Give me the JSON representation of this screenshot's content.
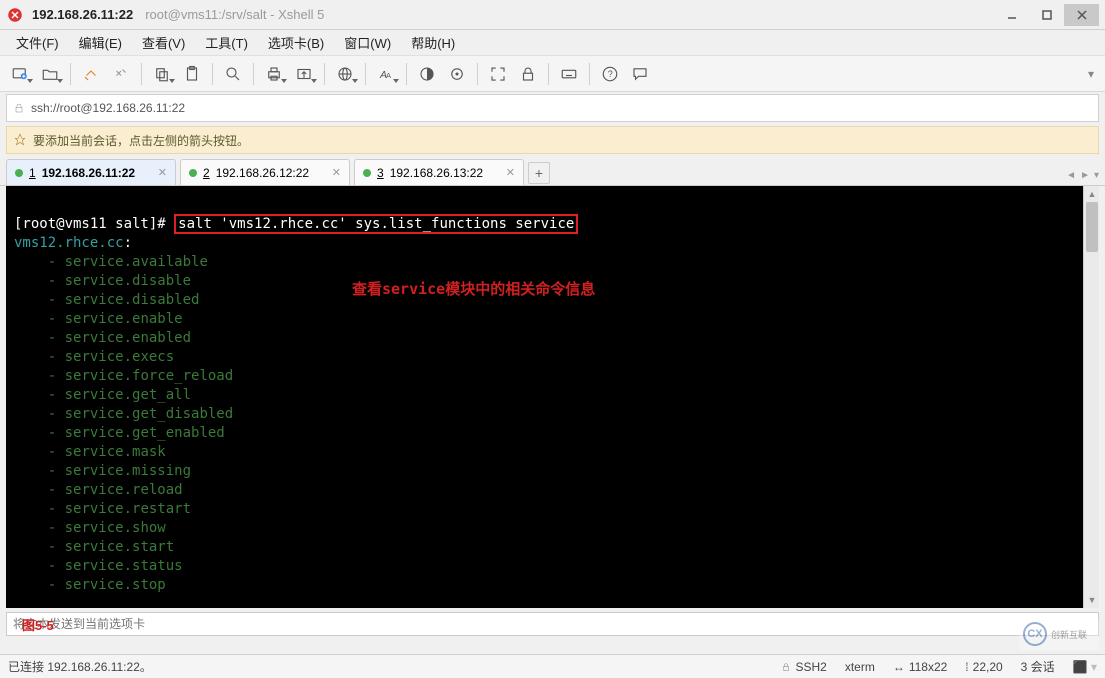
{
  "window": {
    "host": "192.168.26.11:22",
    "subtitle": "root@vms11:/srv/salt - Xshell 5"
  },
  "menu": {
    "file": "文件(F)",
    "edit": "编辑(E)",
    "view": "查看(V)",
    "tools": "工具(T)",
    "tabs": "选项卡(B)",
    "window": "窗口(W)",
    "help": "帮助(H)"
  },
  "address": "ssh://root@192.168.26.11:22",
  "info_bar": "要添加当前会话，点击左侧的箭头按钮。",
  "tabs": [
    {
      "num": "1",
      "label": "192.168.26.11:22",
      "active": true
    },
    {
      "num": "2",
      "label": "192.168.26.12:22",
      "active": false
    },
    {
      "num": "3",
      "label": "192.168.26.13:22",
      "active": false
    }
  ],
  "terminal": {
    "prompt": "[root@vms11 salt]# ",
    "command": "salt 'vms12.rhce.cc' sys.list_functions service",
    "host_output": "vms12.rhce.cc",
    "functions": [
      "service.available",
      "service.disable",
      "service.disabled",
      "service.enable",
      "service.enabled",
      "service.execs",
      "service.force_reload",
      "service.get_all",
      "service.get_disabled",
      "service.get_enabled",
      "service.mask",
      "service.missing",
      "service.reload",
      "service.restart",
      "service.show",
      "service.start",
      "service.status",
      "service.stop"
    ],
    "annotation": "查看service模块中的相关命令信息"
  },
  "bottom": {
    "placeholder": "将文本发送到当前选项卡",
    "figure_label": "图5-5"
  },
  "status": {
    "left": "已连接 192.168.26.11:22。",
    "ssh": "SSH2",
    "term": "xterm",
    "size": "118x22",
    "pos": "22,20",
    "sessions": "3 会话"
  },
  "watermark": "创新互联"
}
